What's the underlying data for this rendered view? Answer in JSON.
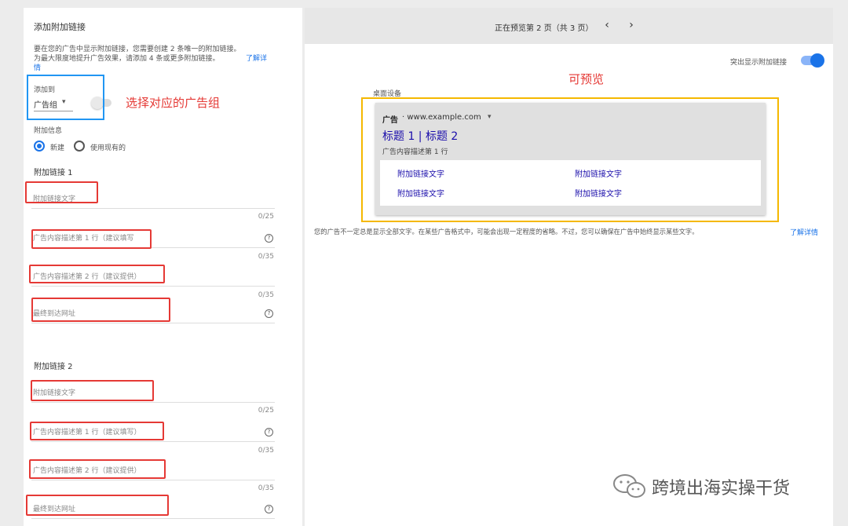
{
  "left": {
    "title": "添加附加链接",
    "description_1": "要在您的广告中显示附加链接，您需要创建 2 条唯一的附加链接。",
    "description_2": "为最大限度地提升广告效果，请添加 4 条或更多附加链接。",
    "learn_more_part1": "了解详",
    "learn_more_part2": "情",
    "add_to_label": "添加到",
    "ad_group_select": "广告组",
    "extra_info_label": "附加信息",
    "radio_new": "新建",
    "radio_existing": "使用现有的",
    "sitelink1_heading": "附加链接 1",
    "sitelink2_heading": "附加链接 2",
    "fields": {
      "link_text": "附加链接文字",
      "desc_line1": "广告内容描述第 1 行（建议填写",
      "desc_line1_full": "广告内容描述第 1 行（建议填写）",
      "desc_line2": "广告内容描述第 2 行（建议提供）",
      "final_url": "最终到达网址"
    },
    "counters": {
      "c25": "0/25",
      "c35": "0/35"
    },
    "help_icon_glyph": "?"
  },
  "right": {
    "pagination": "正在预览第 2 页（共 3 页）",
    "prev_glyph": "‹",
    "next_glyph": "›",
    "highlight_toggle_label": "突出显示附加链接",
    "device_label": "桌面设备",
    "ad": {
      "badge": "广告",
      "url": "· www.example.com",
      "dropdown_glyph": "▾",
      "headline": "标题 1 | 标题 2",
      "description": "广告内容描述第 1 行",
      "sitelinks": [
        "附加链接文字",
        "附加链接文字",
        "附加链接文字",
        "附加链接文字"
      ]
    },
    "disclaimer": "您的广告不一定总是显示全部文字。在某些广告格式中，可能会出现一定程度的省略。不过，您可以确保在广告中始终显示某些文字。",
    "disclaimer_link": "了解详情"
  },
  "annotations": {
    "select_ad_group": "选择对应的广告组",
    "preview": "可预览"
  },
  "watermark": {
    "text": "跨境出海实操干货",
    "icon": "wechat-icon"
  },
  "colors": {
    "red_box": "#e53935",
    "blue_box": "#2196f3",
    "yellow_box": "#f5b800",
    "link_blue": "#1a73e8",
    "annotation_red": "#e53935"
  }
}
